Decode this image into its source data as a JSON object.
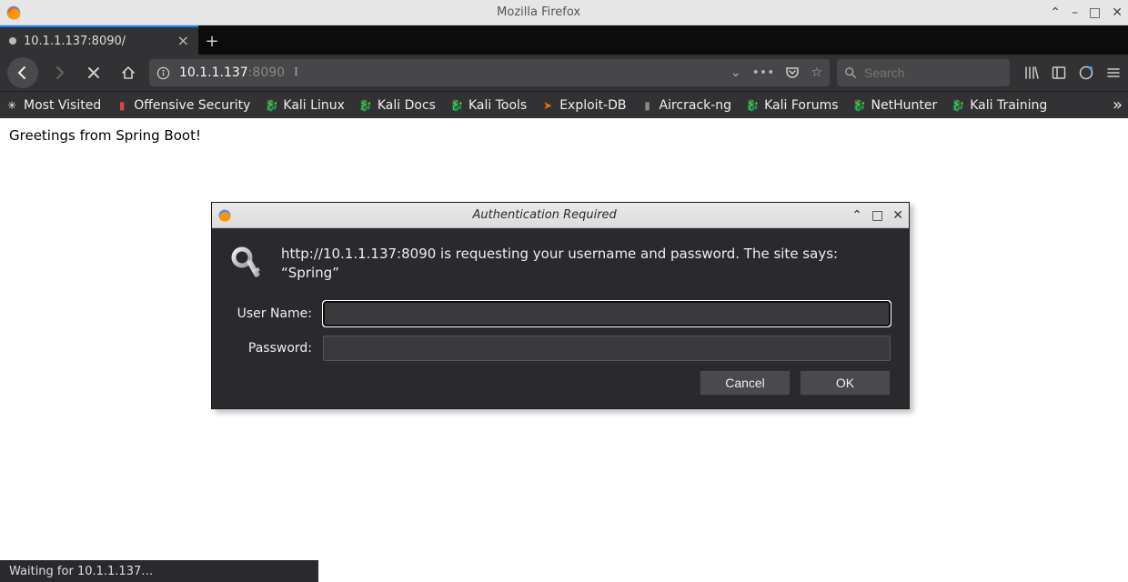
{
  "window": {
    "title": "Mozilla Firefox"
  },
  "tab": {
    "title": "10.1.1.137:8090/"
  },
  "url": {
    "host": "10.1.1.137",
    "port": ":8090"
  },
  "search": {
    "placeholder": "Search"
  },
  "bookmarks": [
    "Most Visited",
    "Offensive Security",
    "Kali Linux",
    "Kali Docs",
    "Kali Tools",
    "Exploit-DB",
    "Aircrack-ng",
    "Kali Forums",
    "NetHunter",
    "Kali Training"
  ],
  "page": {
    "body": "Greetings from Spring Boot!"
  },
  "dialog": {
    "title": "Authentication Required",
    "message": "http://10.1.1.137:8090 is requesting your username and password. The site says: “Spring”",
    "username_label": "User Name:",
    "password_label": "Password:",
    "username_value": "",
    "password_value": "",
    "cancel": "Cancel",
    "ok": "OK"
  },
  "status": {
    "text": "Waiting for 10.1.1.137…"
  }
}
